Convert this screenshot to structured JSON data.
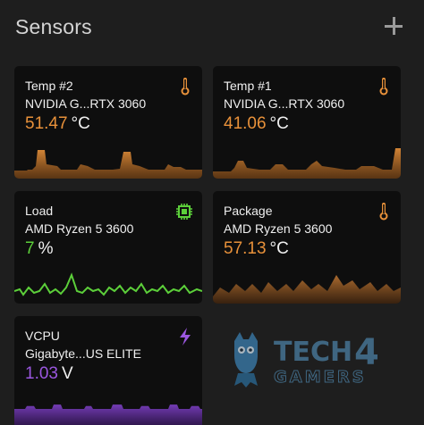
{
  "header": {
    "title": "Sensors",
    "add_icon": "plus-icon"
  },
  "cards": [
    {
      "label": "Temp #2",
      "device": "NVIDIA G...RTX 3060",
      "value": "51.47",
      "unit": "°C",
      "color": "#e8913a",
      "icon": "thermometer-icon"
    },
    {
      "label": "Temp #1",
      "device": "NVIDIA G...RTX 3060",
      "value": "41.06",
      "unit": "°C",
      "color": "#e8913a",
      "icon": "thermometer-icon"
    },
    {
      "label": "Load",
      "device": "AMD Ryzen 5 3600",
      "value": "7",
      "unit": "%",
      "color": "#5ccf3a",
      "icon": "cpu-chip-icon"
    },
    {
      "label": "Package",
      "device": "AMD Ryzen 5 3600",
      "value": "57.13",
      "unit": "°C",
      "color": "#e8913a",
      "icon": "thermometer-icon"
    },
    {
      "label": "VCPU",
      "device": "Gigabyte...US ELITE",
      "value": "1.03",
      "unit": "V",
      "color": "#9b57e0",
      "icon": "lightning-icon"
    }
  ],
  "watermark": {
    "line1": "TECH",
    "digit": "4",
    "line2": "GAMERS"
  }
}
